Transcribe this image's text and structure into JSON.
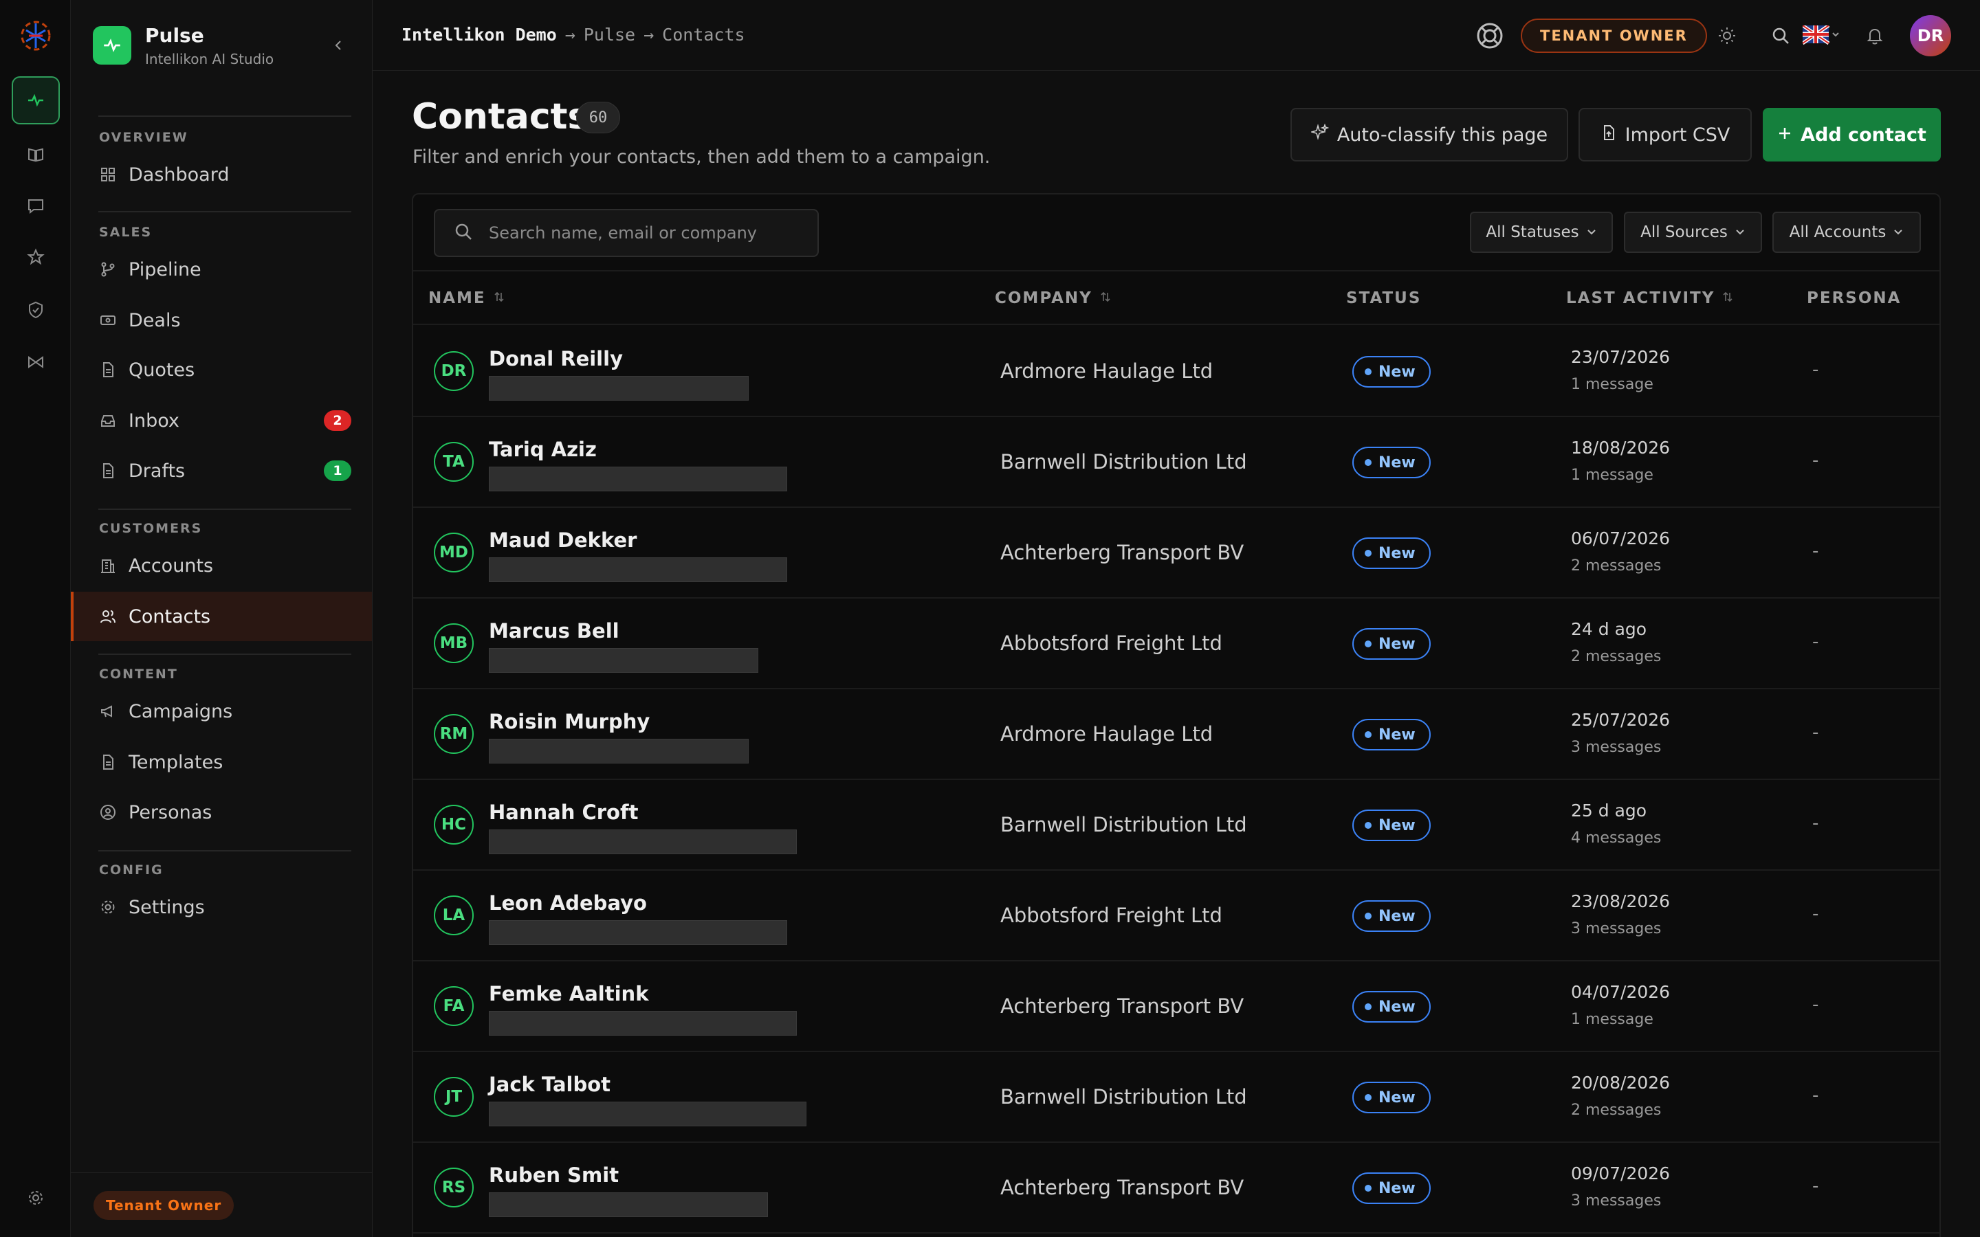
{
  "topbar": {
    "breadcrumb": [
      "Intellikon Demo",
      "Pulse",
      "Contacts"
    ],
    "separator": "→",
    "role_chip": "TENANT OWNER",
    "avatar_initials": "DR",
    "icons": [
      "help-ring-icon",
      "sun-icon",
      "search-icon",
      "uk-flag-icon",
      "bell-icon"
    ]
  },
  "sidebar": {
    "app_name": "Pulse",
    "app_sub": "Intellikon AI Studio",
    "sections": {
      "overview": "OVERVIEW",
      "sales": "SALES",
      "customers": "CUSTOMERS",
      "content": "CONTENT",
      "config": "CONFIG"
    },
    "items": {
      "dashboard": "Dashboard",
      "pipeline": "Pipeline",
      "deals": "Deals",
      "quotes": "Quotes",
      "inbox": "Inbox",
      "inbox_badge": "2",
      "drafts": "Drafts",
      "drafts_badge": "1",
      "accounts": "Accounts",
      "contacts": "Contacts",
      "campaigns": "Campaigns",
      "templates": "Templates",
      "personas": "Personas",
      "settings": "Settings"
    },
    "tenant_pill": "Tenant Owner"
  },
  "header": {
    "title": "Contacts",
    "count": "60",
    "subtitle": "Filter and enrich your contacts, then add them to a campaign.",
    "auto_classify": "Auto-classify this page",
    "import_csv": "Import CSV",
    "add_contact": "Add contact"
  },
  "filters": {
    "search_placeholder": "Search name, email or company",
    "statuses": "All Statuses",
    "sources": "All Sources",
    "accounts": "All Accounts"
  },
  "columns": {
    "name": "NAME",
    "company": "COMPANY",
    "status": "STATUS",
    "last_activity": "LAST ACTIVITY",
    "persona": "PERSONA"
  },
  "rows": [
    {
      "initials": "DR",
      "name": "Donal Reilly",
      "company": "Ardmore Haulage Ltd",
      "status": "New",
      "date": "23/07/2026",
      "messages": "1 message",
      "persona": "-"
    },
    {
      "initials": "TA",
      "name": "Tariq Aziz",
      "company": "Barnwell Distribution Ltd",
      "status": "New",
      "date": "18/08/2026",
      "messages": "1 message",
      "persona": "-"
    },
    {
      "initials": "MD",
      "name": "Maud Dekker",
      "company": "Achterberg Transport BV",
      "status": "New",
      "date": "06/07/2026",
      "messages": "2 messages",
      "persona": "-"
    },
    {
      "initials": "MB",
      "name": "Marcus Bell",
      "company": "Abbotsford Freight Ltd",
      "status": "New",
      "date": "24 d ago",
      "messages": "2 messages",
      "persona": "-"
    },
    {
      "initials": "RM",
      "name": "Roisin Murphy",
      "company": "Ardmore Haulage Ltd",
      "status": "New",
      "date": "25/07/2026",
      "messages": "3 messages",
      "persona": "-"
    },
    {
      "initials": "HC",
      "name": "Hannah Croft",
      "company": "Barnwell Distribution Ltd",
      "status": "New",
      "date": "25 d ago",
      "messages": "4 messages",
      "persona": "-"
    },
    {
      "initials": "LA",
      "name": "Leon Adebayo",
      "company": "Abbotsford Freight Ltd",
      "status": "New",
      "date": "23/08/2026",
      "messages": "3 messages",
      "persona": "-"
    },
    {
      "initials": "FA",
      "name": "Femke Aaltink",
      "company": "Achterberg Transport BV",
      "status": "New",
      "date": "04/07/2026",
      "messages": "1 message",
      "persona": "-"
    },
    {
      "initials": "JT",
      "name": "Jack Talbot",
      "company": "Barnwell Distribution Ltd",
      "status": "New",
      "date": "20/08/2026",
      "messages": "2 messages",
      "persona": "-"
    },
    {
      "initials": "RS",
      "name": "Ruben Smit",
      "company": "Achterberg Transport BV",
      "status": "New",
      "date": "09/07/2026",
      "messages": "3 messages",
      "persona": "-"
    }
  ],
  "colors": {
    "accent_green": "#22c55e",
    "primary_button": "#15803d",
    "active_nav": "#c2410c",
    "status_blue": "#3b82f6"
  }
}
